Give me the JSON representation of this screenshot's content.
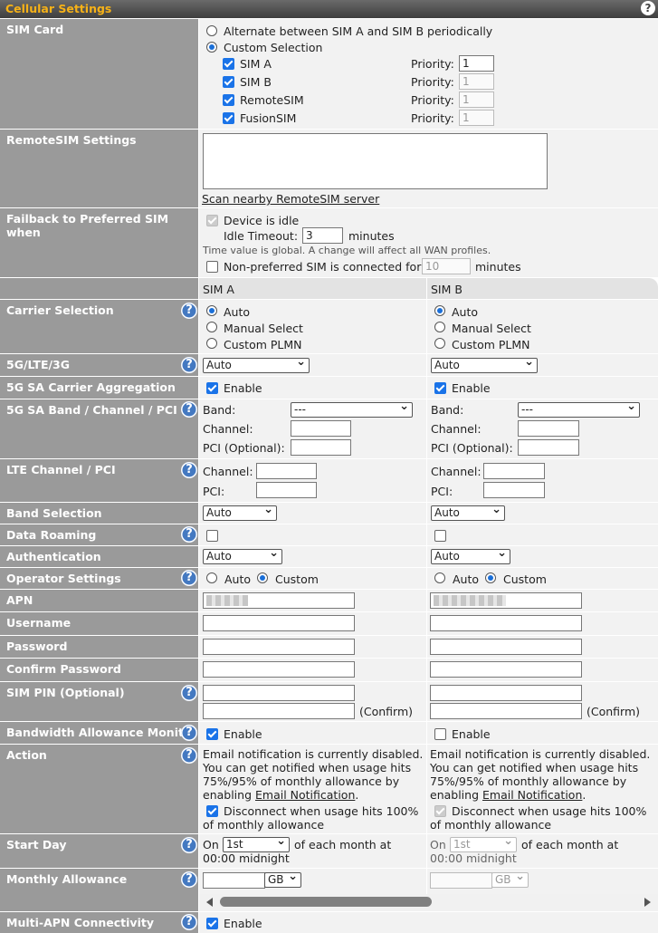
{
  "header": {
    "title": "Cellular Settings",
    "help": "?"
  },
  "sim_card": {
    "label": "SIM Card",
    "opt_alternate": "Alternate between SIM A and SIM B periodically",
    "opt_custom": "Custom Selection",
    "priority_label": "Priority:",
    "sims": [
      {
        "name": "SIM A",
        "priority": "1"
      },
      {
        "name": "SIM B",
        "priority": "1"
      },
      {
        "name": "RemoteSIM",
        "priority": "1"
      },
      {
        "name": "FusionSIM",
        "priority": "1"
      }
    ]
  },
  "remotesim": {
    "label": "RemoteSIM Settings",
    "scan_link": "Scan nearby RemoteSIM server"
  },
  "failback": {
    "label": "Failback to Preferred SIM when",
    "device_idle": "Device is idle",
    "idle_timeout_label": "Idle Timeout:",
    "idle_timeout_value": "3",
    "minutes": "minutes",
    "note": "Time value is global. A change will affect all WAN profiles.",
    "nonpreferred": "Non-preferred SIM is connected for",
    "nonpreferred_value": "10"
  },
  "columns": {
    "a": "SIM A",
    "b": "SIM B"
  },
  "carrier": {
    "label": "Carrier Selection",
    "auto": "Auto",
    "manual": "Manual Select",
    "plmn": "Custom PLMN"
  },
  "network": {
    "label": "5G/LTE/3G",
    "a": "Auto",
    "b": "Auto"
  },
  "ca": {
    "label": "5G SA Carrier Aggregation",
    "enable": "Enable"
  },
  "sa_band": {
    "label": "5G SA Band / Channel / PCI",
    "band": "Band:",
    "band_value": "---",
    "channel": "Channel:",
    "pci_opt": "PCI (Optional):"
  },
  "lte": {
    "label": "LTE Channel / PCI",
    "channel": "Channel:",
    "pci": "PCI:"
  },
  "band_sel": {
    "label": "Band Selection",
    "value": "Auto"
  },
  "roaming": {
    "label": "Data Roaming"
  },
  "auth": {
    "label": "Authentication",
    "value": "Auto"
  },
  "operator": {
    "label": "Operator Settings",
    "auto": "Auto",
    "custom": "Custom"
  },
  "apn": {
    "label": "APN"
  },
  "username": {
    "label": "Username"
  },
  "password": {
    "label": "Password"
  },
  "confirm_password": {
    "label": "Confirm Password"
  },
  "simpin": {
    "label": "SIM PIN (Optional)",
    "confirm": "(Confirm)"
  },
  "bandwidth": {
    "label": "Bandwidth Allowance Monitor",
    "enable": "Enable"
  },
  "action": {
    "label": "Action",
    "line1": "Email notification is currently disabled.",
    "line2": "You can get notified when usage hits",
    "line3": "75%/95% of monthly allowance by",
    "line4_pre": "enabling",
    "line4_link": "Email Notification",
    "line4_post": ".",
    "disconnect1": "Disconnect when usage hits 100%",
    "disconnect2": "of monthly allowance"
  },
  "start_day": {
    "label": "Start Day",
    "on": "On",
    "value": "1st",
    "suffix": "of each month at",
    "time": "00:00 midnight"
  },
  "allowance": {
    "label": "Monthly Allowance",
    "unit": "GB"
  },
  "multi_apn": {
    "label": "Multi-APN Connectivity",
    "enable": "Enable"
  }
}
